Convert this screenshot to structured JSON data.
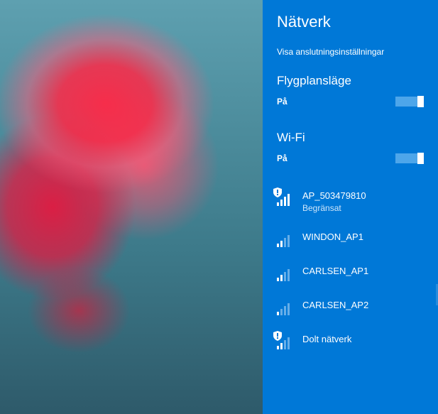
{
  "panel": {
    "title": "Nätverk",
    "settings_link": "Visa anslutningsinställningar",
    "airplane": {
      "heading": "Flygplansläge",
      "state_label": "På"
    },
    "wifi": {
      "heading": "Wi-Fi",
      "state_label": "På"
    },
    "networks": [
      {
        "name": "AP_503479810",
        "status": "Begränsat",
        "strength": 4,
        "shielded": true
      },
      {
        "name": "WINDON_AP1",
        "status": "",
        "strength": 2,
        "shielded": false
      },
      {
        "name": "CARLSEN_AP1",
        "status": "",
        "strength": 2,
        "shielded": false
      },
      {
        "name": "CARLSEN_AP2",
        "status": "",
        "strength": 1,
        "shielded": false
      },
      {
        "name": "Dolt nätverk",
        "status": "",
        "strength": 2,
        "shielded": true
      }
    ]
  }
}
